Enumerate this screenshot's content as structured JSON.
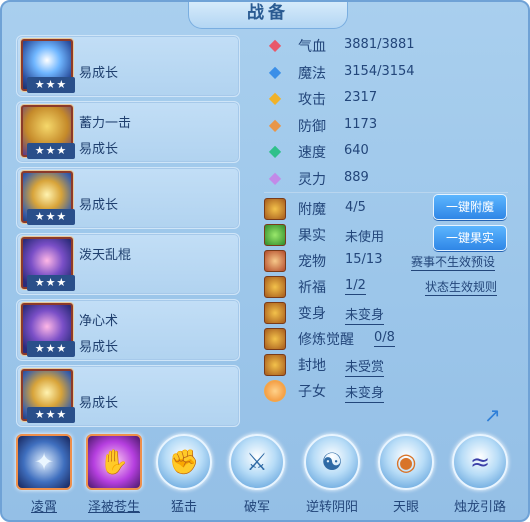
{
  "title": "战备",
  "skills": [
    {
      "name": "",
      "growth": "易成长",
      "stars": "★★★"
    },
    {
      "name": "蓄力一击",
      "growth": "易成长",
      "stars": "★★★"
    },
    {
      "name": "",
      "growth": "易成长",
      "stars": "★★★"
    },
    {
      "name": "泼天乱棍",
      "growth": "",
      "stars": "★★★"
    },
    {
      "name": "净心术",
      "growth": "易成长",
      "stars": "★★★"
    },
    {
      "name": "",
      "growth": "易成长",
      "stars": "★★★"
    }
  ],
  "stats": [
    {
      "label": "气血",
      "value": "3881/3881",
      "icon": "heart-icon",
      "color": "#e8586a"
    },
    {
      "label": "魔法",
      "value": "3154/3154",
      "icon": "diamond-icon",
      "color": "#3b8fe8"
    },
    {
      "label": "攻击",
      "value": "2317",
      "icon": "sword-icon",
      "color": "#f0b22a"
    },
    {
      "label": "防御",
      "value": "1173",
      "icon": "shield-icon",
      "color": "#e8964a"
    },
    {
      "label": "速度",
      "value": "640",
      "icon": "lightning-icon",
      "color": "#2fc08a"
    },
    {
      "label": "灵力",
      "value": "889",
      "icon": "spirit-icon",
      "color": "#c28ae8"
    }
  ],
  "attributes": [
    {
      "label": "附魔",
      "value": "4/5",
      "icon": "enchant-icon"
    },
    {
      "label": "果实",
      "value": "未使用",
      "icon": "fruit-icon"
    },
    {
      "label": "宠物",
      "value": "15/13",
      "icon": "pet-icon"
    },
    {
      "label": "祈福",
      "value": "1/2",
      "icon": "blessing-icon"
    },
    {
      "label": "变身",
      "value": "未变身",
      "icon": "transform-icon"
    },
    {
      "label": "修炼觉醒",
      "value": "0/8",
      "icon": "cultivation-icon"
    },
    {
      "label": "封地",
      "value": "未受赏",
      "icon": "fief-icon"
    },
    {
      "label": "子女",
      "value": "未变身",
      "icon": "children-icon"
    }
  ],
  "buttons": {
    "one_click_enchant": "一键附魔",
    "one_click_fruit": "一键果实"
  },
  "links": {
    "event_preset": "赛事不生效预设",
    "status_rules": "状态生效规则"
  },
  "bottom_skills": [
    {
      "label": "凌霄",
      "icon": "lingxiao-icon",
      "glyph": "✦"
    },
    {
      "label": "泽被苍生",
      "icon": "zebei-icon",
      "glyph": "✋"
    },
    {
      "label": "猛击",
      "icon": "fist-icon",
      "glyph": "✊"
    },
    {
      "label": "破军",
      "icon": "break-army-icon",
      "glyph": "⚔"
    },
    {
      "label": "逆转阴阳",
      "icon": "yinyang-icon",
      "glyph": "☯"
    },
    {
      "label": "天眼",
      "icon": "eye-icon",
      "glyph": "◉"
    },
    {
      "label": "烛龙引路",
      "icon": "dragon-icon",
      "glyph": "≈"
    }
  ]
}
